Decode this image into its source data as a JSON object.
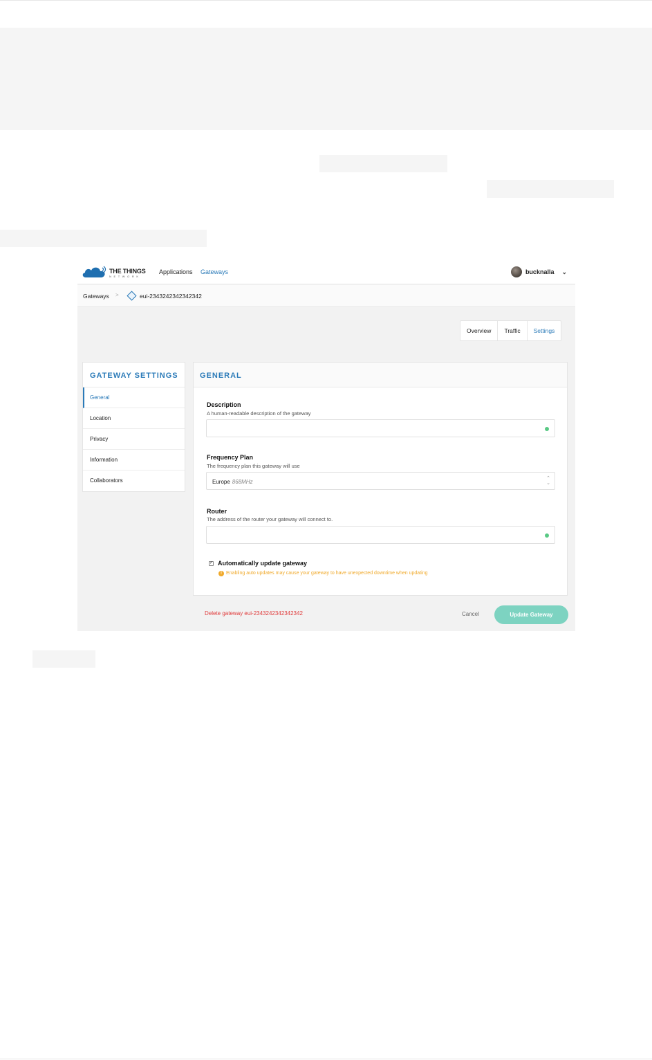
{
  "app": {
    "logo_name": "THE THINGS",
    "logo_sub": "NETWORK",
    "nav": [
      {
        "label": "Applications",
        "active": false
      },
      {
        "label": "Gateways",
        "active": true
      }
    ],
    "user": {
      "name": "bucknalla"
    }
  },
  "breadcrumb": {
    "root": "Gateways",
    "separator": ">",
    "current": "eui-2343242342342342"
  },
  "tabs": [
    {
      "label": "Overview",
      "active": false
    },
    {
      "label": "Traffic",
      "active": false
    },
    {
      "label": "Settings",
      "active": true
    }
  ],
  "sidebar": {
    "title": "GATEWAY SETTINGS",
    "items": [
      {
        "label": "General",
        "active": true
      },
      {
        "label": "Location",
        "active": false
      },
      {
        "label": "Privacy",
        "active": false
      },
      {
        "label": "Information",
        "active": false
      },
      {
        "label": "Collaborators",
        "active": false
      }
    ]
  },
  "panel": {
    "title": "GENERAL",
    "description": {
      "label": "Description",
      "help": "A human-readable description of the gateway",
      "value": ""
    },
    "frequency_plan": {
      "label": "Frequency Plan",
      "help": "The frequency plan this gateway will use",
      "value": "Europe",
      "value_detail": "868MHz"
    },
    "router": {
      "label": "Router",
      "help": "The address of the router your gateway will connect to.",
      "value": ""
    },
    "auto_update": {
      "label": "Automatically update gateway",
      "checked": true,
      "warning": "Enabling auto updates may cause your gateway to have unexpected downtime when updating"
    }
  },
  "actions": {
    "delete": "Delete gateway eui-2343242342342342",
    "cancel": "Cancel",
    "update": "Update Gateway"
  },
  "colors": {
    "accent": "#2a7ab8",
    "danger": "#e03a3a",
    "warning": "#f0a92a",
    "primary_button": "#7dd3c1",
    "valid": "#59c984"
  }
}
